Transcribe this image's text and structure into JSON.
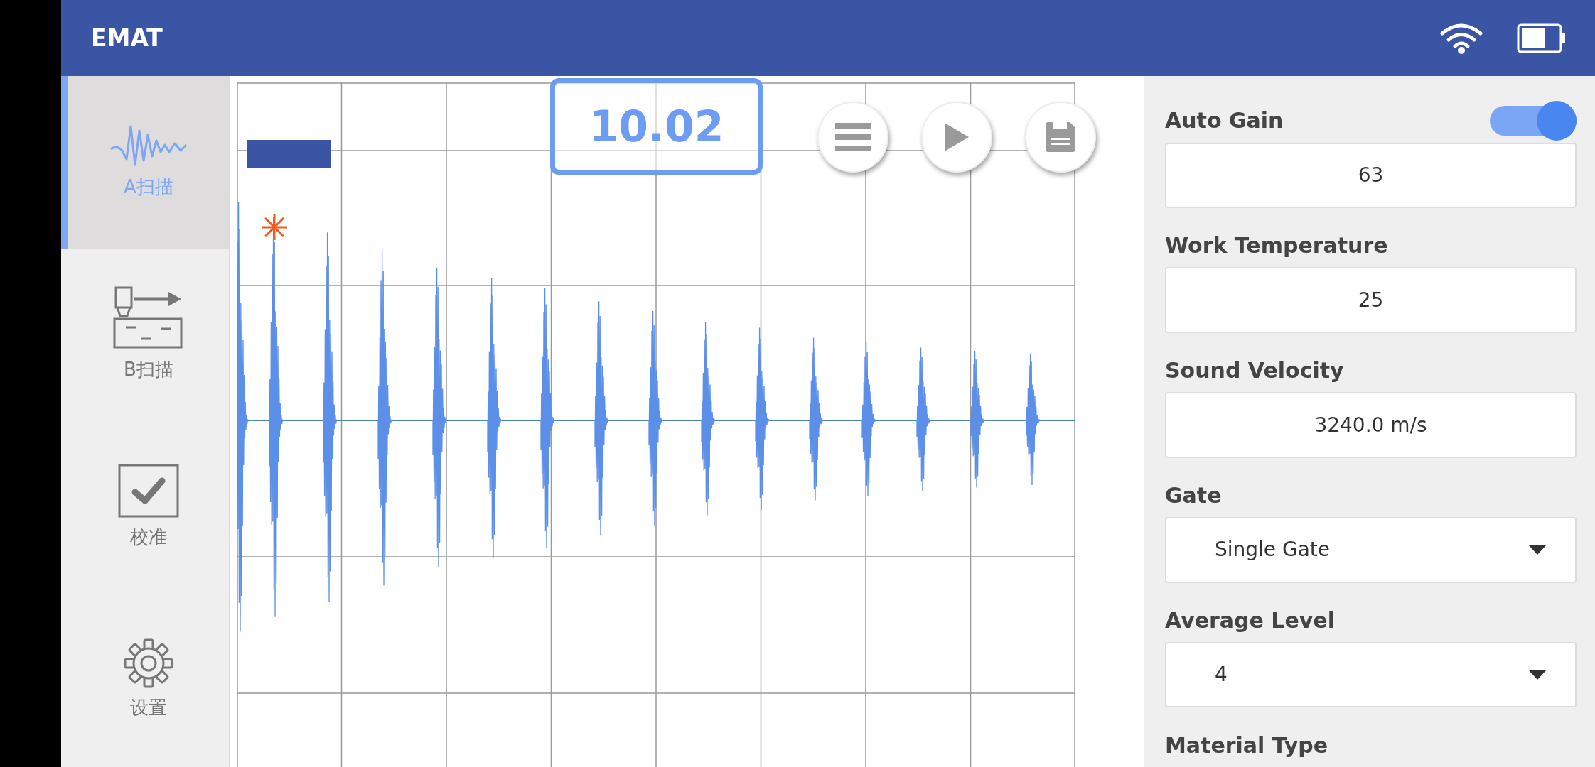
{
  "app_bar": {
    "title": "EMAT"
  },
  "nav": [
    {
      "kind": "ascan",
      "label": "A扫描",
      "selected": true
    },
    {
      "kind": "bscan",
      "label": "B扫描",
      "selected": false
    },
    {
      "kind": "calibrate",
      "label": "校准",
      "selected": false
    },
    {
      "kind": "settings",
      "label": "设置",
      "selected": false
    }
  ],
  "scope": {
    "reading": "10.02"
  },
  "settings": [
    {
      "kind": "input",
      "label": "Auto Gain",
      "auto_switch_on": true,
      "value": "63"
    },
    {
      "kind": "input",
      "label": "Work Temperature",
      "value": "25"
    },
    {
      "kind": "input",
      "label": "Sound Velocity",
      "value": "3240.0 m/s"
    },
    {
      "kind": "select",
      "label": "Gate",
      "value": "Single Gate"
    },
    {
      "kind": "select",
      "label": "Average Level",
      "value": "4"
    },
    {
      "kind": "heading",
      "label": "Material Type"
    }
  ]
}
